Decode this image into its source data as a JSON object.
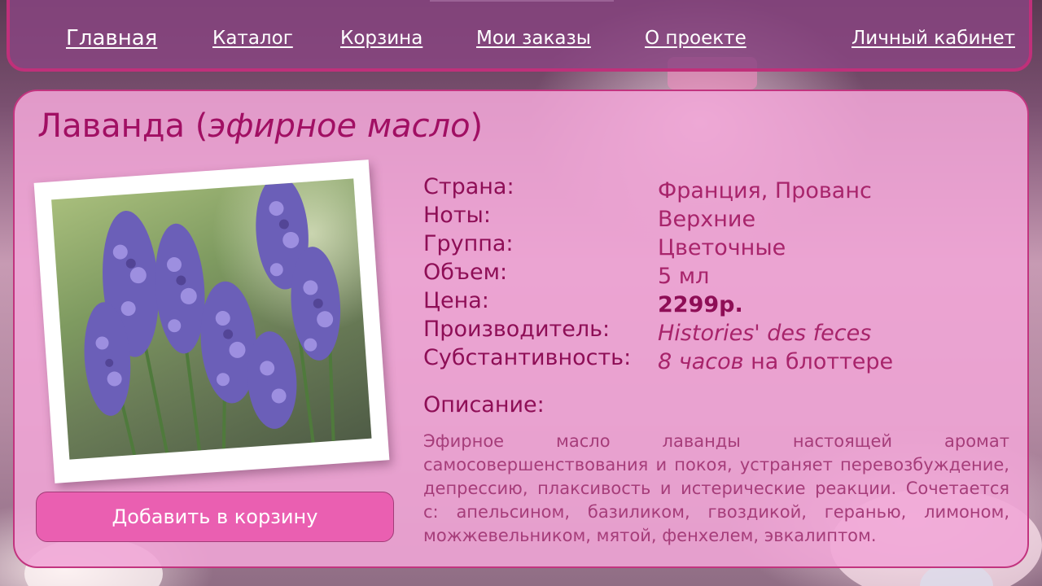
{
  "nav": {
    "home": "Главная",
    "catalog": "Каталог",
    "cart": "Корзина",
    "orders": "Мои заказы",
    "about": "О проекте",
    "account": "Личный кабинет"
  },
  "product": {
    "title_main": "Лаванда (",
    "title_italic": "эфирное масло",
    "title_close": ")",
    "image": {
      "icon": "lavender-photo",
      "alt": "Лаванда"
    },
    "add_to_cart": "Добавить в корзину",
    "specs": {
      "country_label": "Страна:",
      "country": "Франция, Прованс",
      "notes_label": "Ноты:",
      "notes": "Верхние",
      "group_label": "Группа:",
      "group": "Цветочные",
      "volume_label": "Объем:",
      "volume": "5 мл",
      "price_label": "Цена:",
      "price": "2299р.",
      "maker_label": "Производитель:",
      "maker": "Histories' des feces",
      "substantivity_label": "Субстантивность:",
      "substantivity_italic": "8 часов",
      "substantivity_rest": " на блоттере"
    },
    "description_heading": "Описание:",
    "description": "Эфирное масло лаванды настоящей аромат самосовершенствования и покоя, устраняет перевозбуждение, депрессию, плаксивость и истерические реакции. Сочетается с: апельсином, базиликом, гвоздикой, геранью, лимоном, можжевельником, мятой, фенхелем, эвкалиптом."
  },
  "colors": {
    "accent": "#c0307a",
    "title": "#a10f63",
    "button": "#ea5fb1",
    "card": "#f0a5d6"
  }
}
